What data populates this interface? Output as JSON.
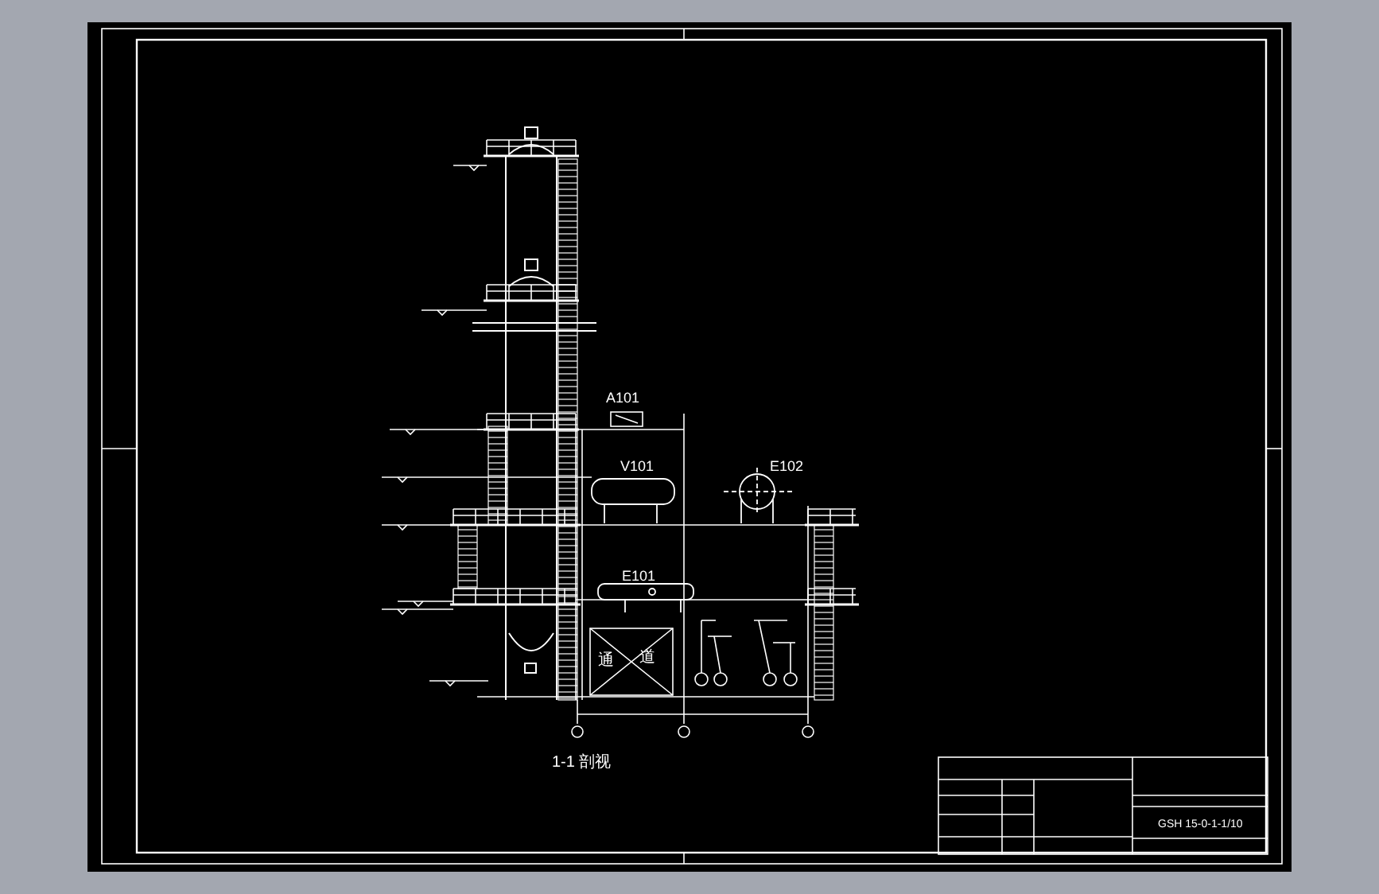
{
  "drawing": {
    "equipment_labels": [
      {
        "text": "A101"
      },
      {
        "text": "V101"
      },
      {
        "text": "E102"
      },
      {
        "text": "E101"
      }
    ],
    "passage_labels": [
      "通",
      "道"
    ],
    "section_title": "1-1 剖视"
  },
  "title_block": {
    "drawing_number": "GSH 15-0-1-1/10"
  }
}
